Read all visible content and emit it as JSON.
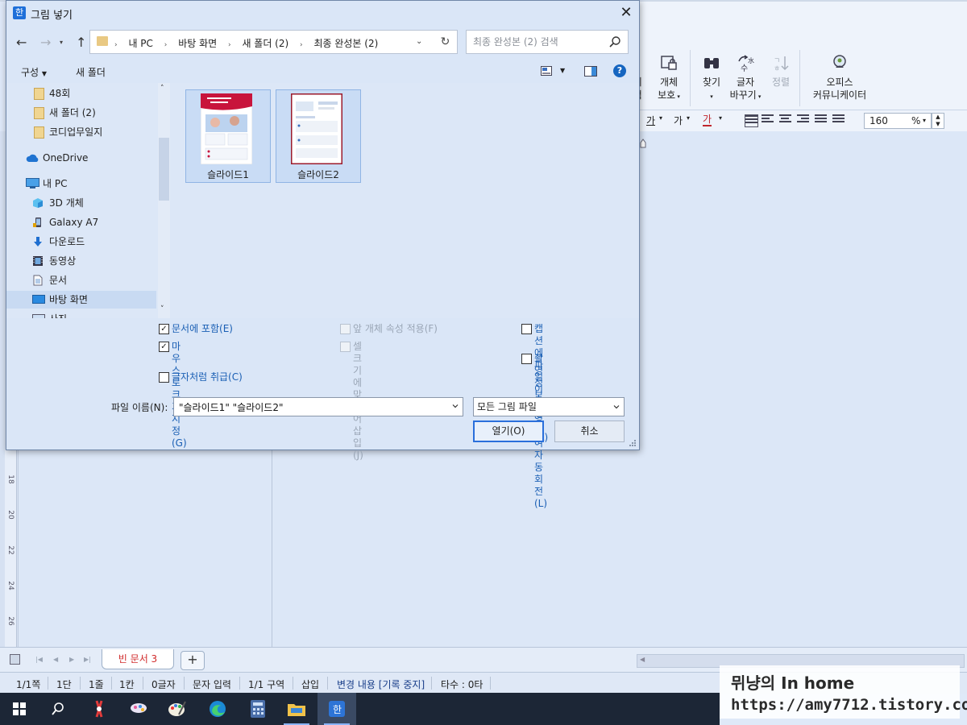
{
  "app": {
    "ribbon": {
      "partial_object_label_1": "체",
      "partial_object_label_2": "택",
      "object_protect": "개체\n보호",
      "find": "찾기",
      "replace": "글자\n바꾸기",
      "sort": "정렬",
      "office_communicator": "오피스\n커뮤니케이터"
    },
    "format_bar": {
      "font_btn1": "가",
      "font_btn2": "가",
      "font_color": "가",
      "zoom_value": "160",
      "zoom_unit": "%"
    },
    "ruler_numbers": [
      "18",
      "20",
      "22",
      "24",
      "26"
    ],
    "tab_bar": {
      "doc_tab": "빈 문서 3",
      "add_tab": "+"
    },
    "status_bar": [
      "1/1쪽",
      "1단",
      "1줄",
      "1칸",
      "0글자",
      "문자 입력",
      "1/1 구역",
      "삽입",
      "변경 내용 [기록 중지]",
      "타수 : 0타"
    ],
    "watermark": {
      "line1": "뮈냥의 In home",
      "line2": "https://amy7712.tistory.com"
    },
    "taskbar_apps": [
      "start-icon",
      "search-icon",
      "snipping-tool-icon",
      "paint-3d-icon",
      "paint-icon",
      "edge-icon",
      "calculator-icon",
      "file-explorer-icon",
      "hwp-icon"
    ]
  },
  "dialog": {
    "title": "그림 넣기",
    "title_icon": "한",
    "address": [
      "내 PC",
      "바탕 화면",
      "새 폴더 (2)",
      "최종 완성본 (2)"
    ],
    "search_placeholder": "최종 완성본 (2) 검색",
    "toolbar": {
      "organize": "구성",
      "new_folder": "새 폴더",
      "help": "?"
    },
    "nav_items": [
      {
        "label": "48회",
        "icon": "folder-icon",
        "selected": false
      },
      {
        "label": "새 폴더 (2)",
        "icon": "folder-icon",
        "selected": false
      },
      {
        "label": "코디업무일지",
        "icon": "folder-icon",
        "selected": false
      },
      {
        "label": "OneDrive",
        "icon": "onedrive-icon",
        "selected": false
      },
      {
        "label": "내 PC",
        "icon": "pc-icon",
        "selected": false
      },
      {
        "label": "3D 개체",
        "icon": "3d-objects-icon",
        "selected": false
      },
      {
        "label": "Galaxy A7",
        "icon": "phone-icon",
        "selected": false
      },
      {
        "label": "다운로드",
        "icon": "download-icon",
        "selected": false
      },
      {
        "label": "동영상",
        "icon": "video-icon",
        "selected": false
      },
      {
        "label": "문서",
        "icon": "document-icon",
        "selected": false
      },
      {
        "label": "바탕 화면",
        "icon": "desktop-icon",
        "selected": true
      },
      {
        "label": "사진",
        "icon": "pictures-icon",
        "selected": false
      }
    ],
    "files": [
      {
        "name": "슬라이드1",
        "selected": true
      },
      {
        "name": "슬라이드2",
        "selected": true
      }
    ],
    "options": {
      "include_in_doc": {
        "label": "문서에 포함(E)",
        "checked": true,
        "enabled": true
      },
      "size_by_mouse": {
        "label": "마우스로 크기 지정\n(G)",
        "checked": true,
        "enabled": true
      },
      "treat_as_char": {
        "label": "글자처럼 취급(C)",
        "checked": false,
        "enabled": true
      },
      "apply_prev_props": {
        "label": "앞 개체 속성 적용(F)",
        "checked": false,
        "enabled": false
      },
      "fit_cell_size": {
        "label": "셀 크기에 맞추어 삽\n입(J)",
        "checked": false,
        "enabled": false
      },
      "filename_caption": {
        "label": "캡션에 파일 이름 넣\n기(K)",
        "checked": false,
        "enabled": true
      },
      "auto_rotate": {
        "label": "촬영 정보 반영하여\n자동 회전(L)",
        "checked": false,
        "enabled": true
      }
    },
    "filename_label": "파일 이름(N):",
    "filename_value": "\"슬라이드1\" \"슬라이드2\"",
    "filetype": "모든 그림 파일",
    "open_label": "열기(O)",
    "cancel_label": "취소"
  },
  "colors": {
    "accent": "#2a6fdb",
    "link_text": "#1a5fb4",
    "tab_text": "#d02a2a",
    "slide1_header": "#c8143c",
    "slide2_border": "#9b1b2c"
  }
}
